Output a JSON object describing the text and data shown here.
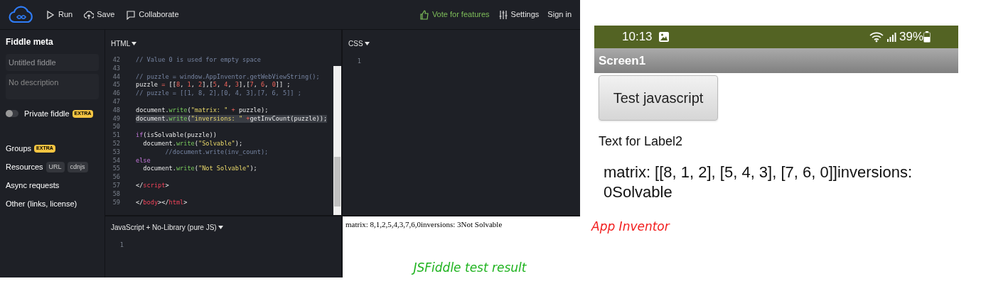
{
  "toolbar": {
    "actions": [
      {
        "kind": "run",
        "label": "Run"
      },
      {
        "kind": "save",
        "label": "Save"
      },
      {
        "kind": "collaborate",
        "label": "Collaborate"
      }
    ],
    "right": [
      {
        "kind": "vote",
        "label": "Vote for features"
      },
      {
        "kind": "settings",
        "label": "Settings"
      },
      {
        "kind": "signin",
        "label": "Sign in"
      }
    ]
  },
  "sidebar": {
    "title": "Fiddle meta",
    "title_placeholder": "Untitled fiddle",
    "description_placeholder": "No description",
    "private": {
      "label": "Private fiddle",
      "badge": "EXTRA",
      "on": false
    },
    "items": [
      {
        "label": "Groups",
        "badges": [
          {
            "kind": "extra",
            "text": "EXTRA"
          }
        ]
      },
      {
        "label": "Resources",
        "badges": [
          {
            "kind": "tag",
            "text": "URL"
          },
          {
            "kind": "tag",
            "text": "cdnjs"
          }
        ]
      },
      {
        "label": "Async requests"
      },
      {
        "label": "Other (links, license)"
      }
    ]
  },
  "html_panel": {
    "label": "HTML",
    "lines": [
      {
        "no": "42",
        "highlighted": false,
        "tokens": [
          {
            "kind": "comment",
            "text": "// Value 0 is used for empty space"
          }
        ]
      },
      {
        "no": "43",
        "highlighted": false
      },
      {
        "no": "44",
        "highlighted": false,
        "tokens": [
          {
            "kind": "comment",
            "text": "// puzzle = window.AppInventor.getWebViewString();"
          }
        ]
      },
      {
        "no": "45",
        "highlighted": false,
        "tokens": [
          {
            "kind": "plain",
            "text": "puzzle "
          },
          {
            "kind": "op",
            "text": "="
          },
          {
            "kind": "plain",
            "text": " [["
          },
          {
            "kind": "number",
            "text": "8"
          },
          {
            "kind": "plain",
            "text": ", "
          },
          {
            "kind": "number",
            "text": "1"
          },
          {
            "kind": "plain",
            "text": ", "
          },
          {
            "kind": "number",
            "text": "2"
          },
          {
            "kind": "plain",
            "text": "],["
          },
          {
            "kind": "number",
            "text": "5"
          },
          {
            "kind": "plain",
            "text": ", "
          },
          {
            "kind": "number",
            "text": "4"
          },
          {
            "kind": "plain",
            "text": ", "
          },
          {
            "kind": "number",
            "text": "3"
          },
          {
            "kind": "plain",
            "text": "],["
          },
          {
            "kind": "number",
            "text": "7"
          },
          {
            "kind": "plain",
            "text": ", "
          },
          {
            "kind": "number",
            "text": "6"
          },
          {
            "kind": "plain",
            "text": ", "
          },
          {
            "kind": "number",
            "text": "0"
          },
          {
            "kind": "plain",
            "text": "]] ;"
          }
        ]
      },
      {
        "no": "46",
        "highlighted": false,
        "tokens": [
          {
            "kind": "comment",
            "text": "// puzzle = [[1, 8, 2],[0, 4, 3],[7, 6, 5]] ;"
          }
        ]
      },
      {
        "no": "47",
        "highlighted": false
      },
      {
        "no": "48",
        "highlighted": false,
        "tokens": [
          {
            "kind": "plain",
            "text": "document."
          },
          {
            "kind": "func",
            "text": "write"
          },
          {
            "kind": "plain",
            "text": "("
          },
          {
            "kind": "string",
            "text": "\"matrix: \""
          },
          {
            "kind": "op",
            "text": " + "
          },
          {
            "kind": "plain",
            "text": "puzzle);"
          }
        ]
      },
      {
        "no": "49",
        "highlighted": true,
        "tokens": [
          {
            "kind": "plain",
            "text": "document."
          },
          {
            "kind": "func",
            "text": "write"
          },
          {
            "kind": "plain",
            "text": "("
          },
          {
            "kind": "string",
            "text": "\"inversions: \""
          },
          {
            "kind": "op",
            "text": " +"
          },
          {
            "kind": "plain",
            "text": "getInvCount(puzzle));"
          }
        ]
      },
      {
        "no": "50",
        "highlighted": false
      },
      {
        "no": "51",
        "highlighted": false,
        "tokens": [
          {
            "kind": "keyword",
            "text": "if"
          },
          {
            "kind": "plain",
            "text": "(isSolvable(puzzle))"
          }
        ]
      },
      {
        "no": "52",
        "highlighted": false,
        "tokens": [
          {
            "kind": "plain",
            "text": "  document."
          },
          {
            "kind": "func",
            "text": "write"
          },
          {
            "kind": "plain",
            "text": "("
          },
          {
            "kind": "string",
            "text": "\"Solvable\""
          },
          {
            "kind": "plain",
            "text": ");"
          }
        ]
      },
      {
        "no": "53",
        "highlighted": false,
        "tokens": [
          {
            "kind": "comment",
            "text": "        //document.write(inv_count);"
          }
        ]
      },
      {
        "no": "54",
        "highlighted": false,
        "tokens": [
          {
            "kind": "keyword",
            "text": "else"
          }
        ]
      },
      {
        "no": "55",
        "highlighted": false,
        "tokens": [
          {
            "kind": "plain",
            "text": "  document."
          },
          {
            "kind": "func",
            "text": "write"
          },
          {
            "kind": "plain",
            "text": "("
          },
          {
            "kind": "string",
            "text": "\"Not Solvable\""
          },
          {
            "kind": "plain",
            "text": ");"
          }
        ]
      },
      {
        "no": "56",
        "highlighted": false
      },
      {
        "no": "57",
        "highlighted": false,
        "tokens": [
          {
            "kind": "plain",
            "text": "</"
          },
          {
            "kind": "tag",
            "text": "script"
          },
          {
            "kind": "plain",
            "text": ">"
          }
        ]
      },
      {
        "no": "58",
        "highlighted": false
      },
      {
        "no": "59",
        "highlighted": false,
        "tokens": [
          {
            "kind": "plain",
            "text": "</"
          },
          {
            "kind": "tag",
            "text": "body"
          },
          {
            "kind": "plain",
            "text": "></"
          },
          {
            "kind": "tag",
            "text": "html"
          },
          {
            "kind": "plain",
            "text": ">"
          }
        ]
      }
    ]
  },
  "css_panel": {
    "label": "CSS",
    "lines": [
      "1"
    ]
  },
  "js_panel": {
    "label": "JavaScript + No-Library (pure JS)",
    "lines": [
      "1"
    ]
  },
  "result": {
    "text": "matrix: 8,1,2,5,4,3,7,6,0inversions: 3Not Solvable"
  },
  "jsfiddle_caption": "JSFiddle test result",
  "phone": {
    "time": "10:13",
    "battery": "39%",
    "screen_title": "Screen1",
    "button": "Test javascript",
    "label": "Text for Label2",
    "output": "matrix: [[8, 1, 2], [5, 4, 3], [7, 6, 0]]inversions: 0Solvable"
  },
  "appinventor_caption": "App Inventor"
}
